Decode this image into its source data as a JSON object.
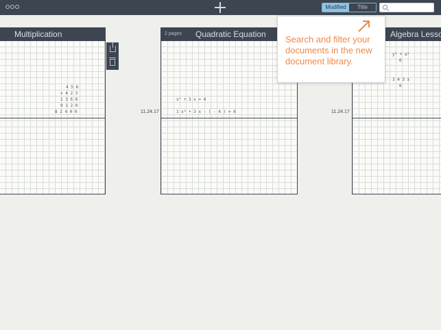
{
  "toolbar": {
    "menu_icon": "more-icon",
    "add_icon": "plus-icon",
    "sort_options": [
      "Modified",
      "Title"
    ],
    "sort_selected": "Modified",
    "search": {
      "icon": "search-icon",
      "value": "",
      "placeholder": ""
    }
  },
  "documents": [
    {
      "title": "Multiplication",
      "pages": "",
      "date": "",
      "math_lines": [
        "4 5 6",
        "× 4 2 3",
        "1 3 6 8",
        "9 1 2 0",
        "8 2 4 0 0"
      ]
    },
    {
      "title": "Quadratic Equation",
      "pages": "2 pages",
      "date": "11.24.17",
      "math_lines": [
        "x² + 3 x = 4",
        "1 x² + 3 x - ( - 4 ) = 0"
      ]
    },
    {
      "title": "Algebra Lesson",
      "pages": "",
      "date": "11.24.17",
      "math_lines": [
        "y² + a²",
        "6",
        "3 4 3 x",
        "6"
      ]
    }
  ],
  "side_toolbar": {
    "share_icon": "share-icon",
    "trash_icon": "trash-icon"
  },
  "popover": {
    "text": "Search and filter your documents in the new document library.",
    "arrow_icon": "arrow-up-right-icon",
    "accent_color": "#f0884a"
  },
  "colors": {
    "toolbar_bg": "#3d4550",
    "selected_segment": "#8fc3e4",
    "background": "#efefeb"
  }
}
